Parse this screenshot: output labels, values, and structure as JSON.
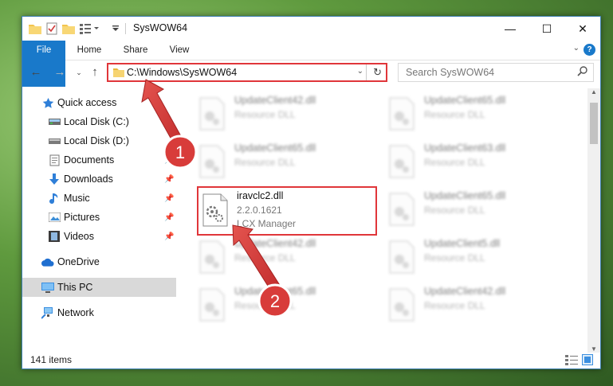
{
  "window": {
    "title": "SysWOW64",
    "controls": {
      "minimize": "—",
      "maximize": "☐",
      "close": "✕"
    }
  },
  "ribbon": {
    "tabs": [
      "File",
      "Home",
      "Share",
      "View"
    ],
    "help": "?"
  },
  "address": {
    "path": "C:\\Windows\\SysWOW64",
    "search_placeholder": "Search SysWOW64"
  },
  "nav": {
    "quick_access": "Quick access",
    "items": [
      {
        "label": "Local Disk (C:)",
        "icon": "drive-icon",
        "pinned": false
      },
      {
        "label": "Local Disk (D:)",
        "icon": "drive-icon",
        "pinned": false
      },
      {
        "label": "Documents",
        "icon": "documents-icon",
        "pinned": true
      },
      {
        "label": "Downloads",
        "icon": "downloads-icon",
        "pinned": true
      },
      {
        "label": "Music",
        "icon": "music-icon",
        "pinned": true
      },
      {
        "label": "Pictures",
        "icon": "pictures-icon",
        "pinned": true
      },
      {
        "label": "Videos",
        "icon": "videos-icon",
        "pinned": true
      }
    ],
    "onedrive": "OneDrive",
    "this_pc": "This PC",
    "network": "Network"
  },
  "files": {
    "left": [
      {
        "name": "UpdateClient42.dll",
        "line2": "Resource DLL"
      },
      {
        "name": "UpdateClient65.dll",
        "line2": "Resource DLL"
      },
      {
        "name": "UpdateClient42.dll",
        "line2": "Resource DLL"
      },
      {
        "name": "UpdateClient65.dll",
        "line2": "Resource DLL"
      }
    ],
    "highlighted": {
      "name": "iravclc2.dll",
      "version": "2.2.0.1621",
      "company": "LCX Manager"
    },
    "right": [
      {
        "name": "UpdateClient65.dll",
        "line2": "Resource DLL"
      },
      {
        "name": "UpdateClient63.dll",
        "line2": "Resource DLL"
      },
      {
        "name": "UpdateClient65.dll",
        "line2": "Resource DLL"
      },
      {
        "name": "UpdateClient5.dll",
        "line2": "Resource DLL"
      },
      {
        "name": "UpdateClient42.dll",
        "line2": "Resource DLL"
      }
    ]
  },
  "status": {
    "count": "141 items"
  },
  "annotations": {
    "step1": "1",
    "step2": "2",
    "accent": "#e0363a"
  }
}
